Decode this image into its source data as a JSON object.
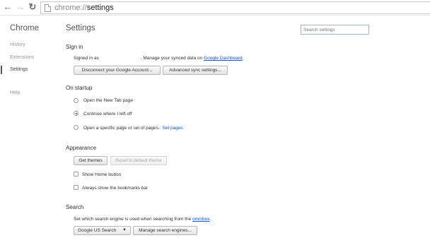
{
  "browser": {
    "url_scheme": "chrome://",
    "url_host": "settings"
  },
  "sidebar": {
    "title": "Chrome",
    "items": [
      {
        "label": "History"
      },
      {
        "label": "Extensions"
      },
      {
        "label": "Settings"
      },
      {
        "label": "Help"
      }
    ]
  },
  "header": {
    "title": "Settings",
    "search_placeholder": "Search settings"
  },
  "sign_in": {
    "heading": "Sign in",
    "signed_in_prefix": "Signed in as",
    "signed_in_suffix": ". Manage your synced data on",
    "dashboard_link": "Google Dashboard",
    "period": ".",
    "disconnect_button": "Disconnect your Google Account...",
    "advanced_sync_button": "Advanced sync settings..."
  },
  "on_startup": {
    "heading": "On startup",
    "options": [
      {
        "label": "Open the New Tab page",
        "selected": false
      },
      {
        "label": "Continue where I left off",
        "selected": true
      },
      {
        "label": "Open a specific page or set of pages.",
        "selected": false
      }
    ],
    "set_pages_link": "Set pages"
  },
  "appearance": {
    "heading": "Appearance",
    "get_themes_button": "Get themes",
    "reset_theme_button": "Reset to default theme",
    "show_home_button": "Show Home button",
    "show_bookmarks_bar": "Always show the bookmarks bar"
  },
  "search": {
    "heading": "Search",
    "description": "Set which search engine is used when searching from the",
    "omnibox_link": "omnibox",
    "period": ".",
    "engine_selected": "Google US Search",
    "manage_button": "Manage search engines..."
  },
  "colors": {
    "link": "#1155cc",
    "text": "#303030",
    "muted": "#999999"
  }
}
